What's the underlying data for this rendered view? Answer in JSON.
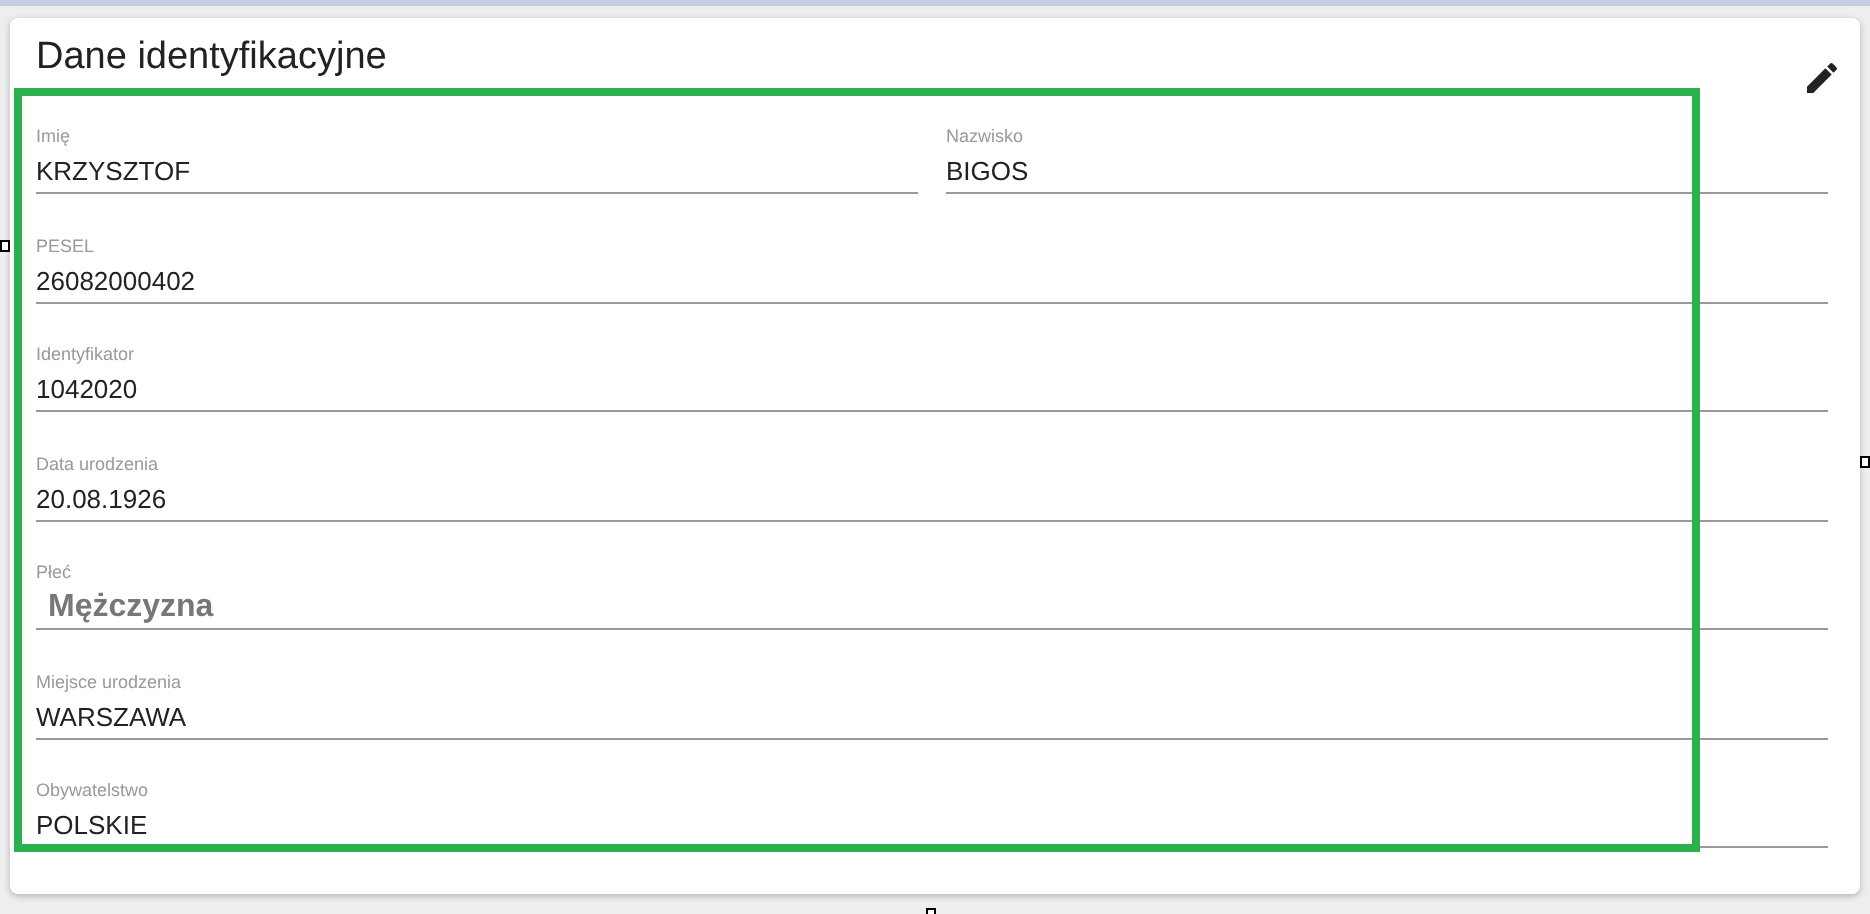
{
  "card": {
    "title": "Dane identyfikacyjne"
  },
  "rows": [
    {
      "fields": [
        {
          "label": "Imię",
          "value": "KRZYSZTOF",
          "kind": "text"
        },
        {
          "label": "Nazwisko",
          "value": "BIGOS",
          "kind": "text"
        }
      ]
    },
    {
      "fields": [
        {
          "label": "PESEL",
          "value": "26082000402",
          "kind": "text"
        }
      ]
    },
    {
      "fields": [
        {
          "label": "Identyfikator",
          "value": "1042020",
          "kind": "text"
        }
      ]
    },
    {
      "fields": [
        {
          "label": "Data urodzenia",
          "value": "20.08.1926",
          "kind": "text"
        }
      ]
    },
    {
      "fields": [
        {
          "label": "Płeć",
          "value": "Mężczyzna",
          "kind": "select"
        }
      ]
    },
    {
      "fields": [
        {
          "label": "Miejsce urodzenia",
          "value": "WARSZAWA",
          "kind": "text"
        }
      ]
    },
    {
      "fields": [
        {
          "label": "Obywatelstwo",
          "value": "POLSKIE",
          "kind": "text"
        }
      ]
    }
  ]
}
